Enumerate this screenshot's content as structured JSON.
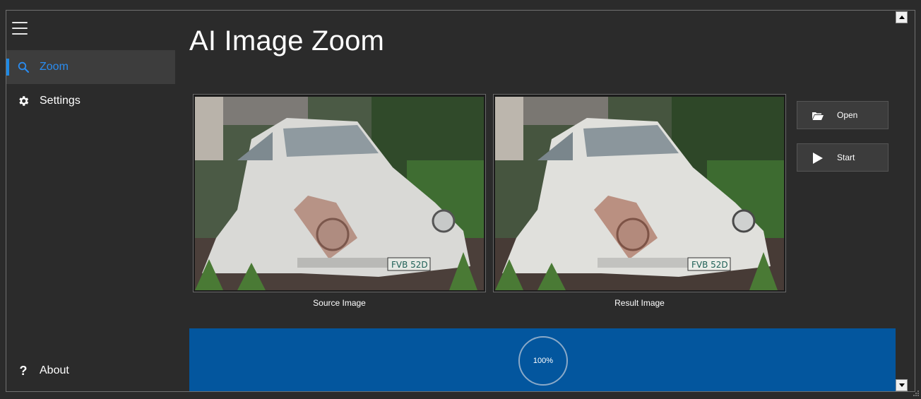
{
  "app": {
    "title": "AI Image Zoom"
  },
  "sidebar": {
    "items": [
      {
        "label": "Zoom",
        "icon": "search-icon"
      },
      {
        "label": "Settings",
        "icon": "gear-icon"
      }
    ],
    "footer": {
      "label": "About",
      "icon": "question-icon"
    }
  },
  "images": {
    "source_caption": "Source Image",
    "result_caption": "Result Image",
    "plate_text": "FVB 52D"
  },
  "actions": {
    "open_label": "Open",
    "start_label": "Start"
  },
  "progress": {
    "label": "100%",
    "value": 1.0
  },
  "colors": {
    "accent": "#1e8ae6",
    "progress_panel": "#03569e",
    "background": "#2b2b2b"
  }
}
